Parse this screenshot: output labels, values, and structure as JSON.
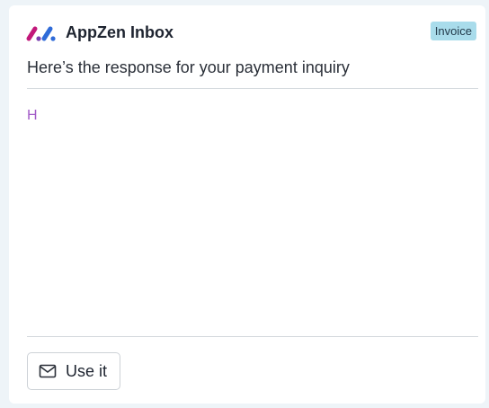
{
  "header": {
    "app_title": "AppZen Inbox",
    "badge": "Invoice",
    "logo_icon": "appzen-logo-icon"
  },
  "message": {
    "subject": "Here’s the response for your payment inquiry",
    "body": "H"
  },
  "actions": {
    "use_label": "Use it",
    "use_icon": "envelope-icon"
  },
  "colors": {
    "badge_bg": "#a9dceb",
    "body_text": "#a25bc8",
    "logo_left": "#c2187a",
    "logo_right": "#2f6bd8"
  }
}
